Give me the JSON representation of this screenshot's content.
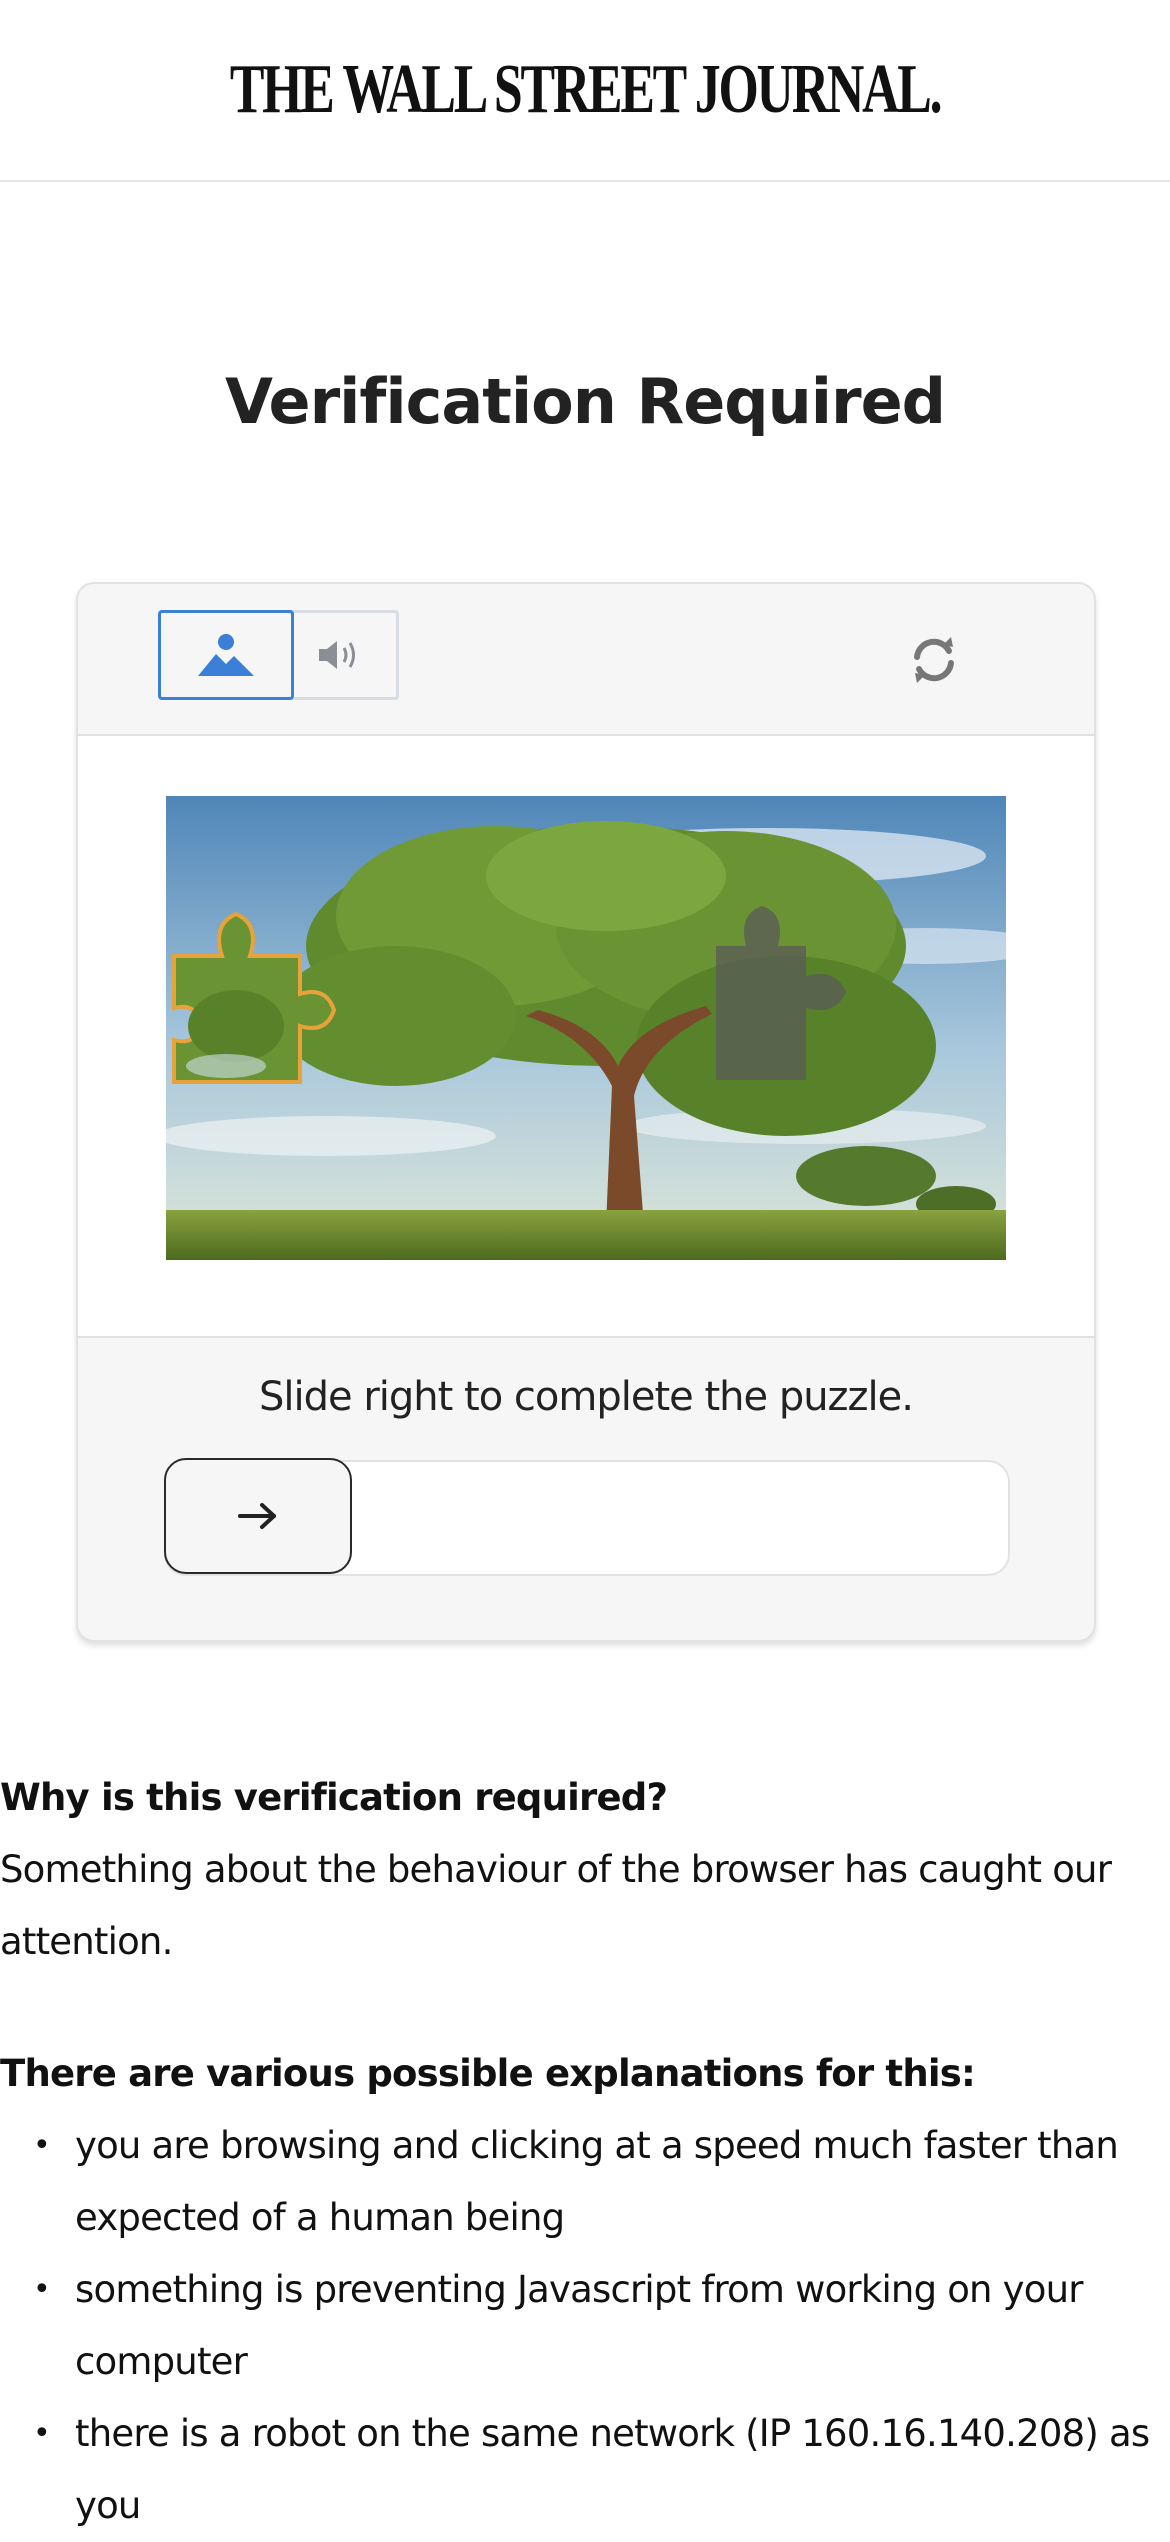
{
  "masthead": {
    "title": "THE WALL STREET JOURNAL."
  },
  "heading": "Verification Required",
  "captcha": {
    "toolbar": {
      "image_mode_icon": "image-mountain-icon",
      "audio_mode_icon": "speaker-icon",
      "refresh_icon": "refresh-icon"
    },
    "instruction": "Slide right to complete the puzzle.",
    "slider_icon": "arrow-right-icon",
    "slider_progress": 0,
    "colors": {
      "accent": "#3b7fd7",
      "piece_outline": "#e8a23a"
    }
  },
  "info": {
    "why_heading": "Why is this verification required?",
    "why_text_line1": "Something about the behaviour of the browser has caught our",
    "why_text_line2": "attention.",
    "explanations_heading": "There are various possible explanations for this:",
    "items": [
      {
        "line1": "you are browsing and clicking at a speed much faster than",
        "line2": "expected of a human being"
      },
      {
        "line1": "something is preventing Javascript from working on your",
        "line2": "computer"
      },
      {
        "line1": "there is a robot on the same network (IP 160.16.140.208) as",
        "line2": "you"
      }
    ]
  }
}
